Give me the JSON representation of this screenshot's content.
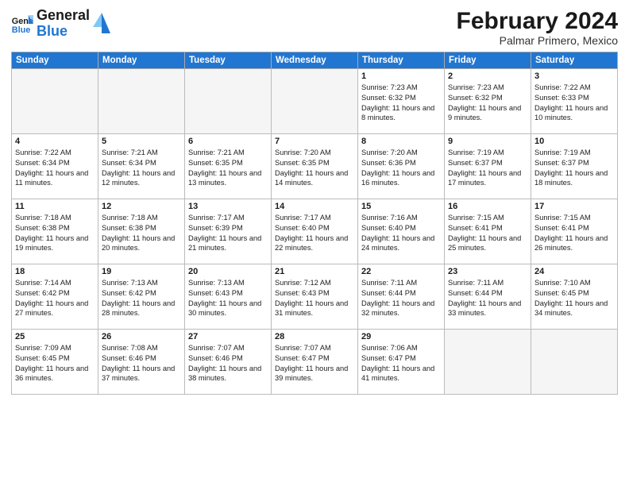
{
  "header": {
    "logo_text_general": "General",
    "logo_text_blue": "Blue",
    "month_title": "February 2024",
    "location": "Palmar Primero, Mexico"
  },
  "weekdays": [
    "Sunday",
    "Monday",
    "Tuesday",
    "Wednesday",
    "Thursday",
    "Friday",
    "Saturday"
  ],
  "weeks": [
    [
      {
        "day": "",
        "info": ""
      },
      {
        "day": "",
        "info": ""
      },
      {
        "day": "",
        "info": ""
      },
      {
        "day": "",
        "info": ""
      },
      {
        "day": "1",
        "info": "Sunrise: 7:23 AM\nSunset: 6:32 PM\nDaylight: 11 hours and 8 minutes."
      },
      {
        "day": "2",
        "info": "Sunrise: 7:23 AM\nSunset: 6:32 PM\nDaylight: 11 hours and 9 minutes."
      },
      {
        "day": "3",
        "info": "Sunrise: 7:22 AM\nSunset: 6:33 PM\nDaylight: 11 hours and 10 minutes."
      }
    ],
    [
      {
        "day": "4",
        "info": "Sunrise: 7:22 AM\nSunset: 6:34 PM\nDaylight: 11 hours and 11 minutes."
      },
      {
        "day": "5",
        "info": "Sunrise: 7:21 AM\nSunset: 6:34 PM\nDaylight: 11 hours and 12 minutes."
      },
      {
        "day": "6",
        "info": "Sunrise: 7:21 AM\nSunset: 6:35 PM\nDaylight: 11 hours and 13 minutes."
      },
      {
        "day": "7",
        "info": "Sunrise: 7:20 AM\nSunset: 6:35 PM\nDaylight: 11 hours and 14 minutes."
      },
      {
        "day": "8",
        "info": "Sunrise: 7:20 AM\nSunset: 6:36 PM\nDaylight: 11 hours and 16 minutes."
      },
      {
        "day": "9",
        "info": "Sunrise: 7:19 AM\nSunset: 6:37 PM\nDaylight: 11 hours and 17 minutes."
      },
      {
        "day": "10",
        "info": "Sunrise: 7:19 AM\nSunset: 6:37 PM\nDaylight: 11 hours and 18 minutes."
      }
    ],
    [
      {
        "day": "11",
        "info": "Sunrise: 7:18 AM\nSunset: 6:38 PM\nDaylight: 11 hours and 19 minutes."
      },
      {
        "day": "12",
        "info": "Sunrise: 7:18 AM\nSunset: 6:38 PM\nDaylight: 11 hours and 20 minutes."
      },
      {
        "day": "13",
        "info": "Sunrise: 7:17 AM\nSunset: 6:39 PM\nDaylight: 11 hours and 21 minutes."
      },
      {
        "day": "14",
        "info": "Sunrise: 7:17 AM\nSunset: 6:40 PM\nDaylight: 11 hours and 22 minutes."
      },
      {
        "day": "15",
        "info": "Sunrise: 7:16 AM\nSunset: 6:40 PM\nDaylight: 11 hours and 24 minutes."
      },
      {
        "day": "16",
        "info": "Sunrise: 7:15 AM\nSunset: 6:41 PM\nDaylight: 11 hours and 25 minutes."
      },
      {
        "day": "17",
        "info": "Sunrise: 7:15 AM\nSunset: 6:41 PM\nDaylight: 11 hours and 26 minutes."
      }
    ],
    [
      {
        "day": "18",
        "info": "Sunrise: 7:14 AM\nSunset: 6:42 PM\nDaylight: 11 hours and 27 minutes."
      },
      {
        "day": "19",
        "info": "Sunrise: 7:13 AM\nSunset: 6:42 PM\nDaylight: 11 hours and 28 minutes."
      },
      {
        "day": "20",
        "info": "Sunrise: 7:13 AM\nSunset: 6:43 PM\nDaylight: 11 hours and 30 minutes."
      },
      {
        "day": "21",
        "info": "Sunrise: 7:12 AM\nSunset: 6:43 PM\nDaylight: 11 hours and 31 minutes."
      },
      {
        "day": "22",
        "info": "Sunrise: 7:11 AM\nSunset: 6:44 PM\nDaylight: 11 hours and 32 minutes."
      },
      {
        "day": "23",
        "info": "Sunrise: 7:11 AM\nSunset: 6:44 PM\nDaylight: 11 hours and 33 minutes."
      },
      {
        "day": "24",
        "info": "Sunrise: 7:10 AM\nSunset: 6:45 PM\nDaylight: 11 hours and 34 minutes."
      }
    ],
    [
      {
        "day": "25",
        "info": "Sunrise: 7:09 AM\nSunset: 6:45 PM\nDaylight: 11 hours and 36 minutes."
      },
      {
        "day": "26",
        "info": "Sunrise: 7:08 AM\nSunset: 6:46 PM\nDaylight: 11 hours and 37 minutes."
      },
      {
        "day": "27",
        "info": "Sunrise: 7:07 AM\nSunset: 6:46 PM\nDaylight: 11 hours and 38 minutes."
      },
      {
        "day": "28",
        "info": "Sunrise: 7:07 AM\nSunset: 6:47 PM\nDaylight: 11 hours and 39 minutes."
      },
      {
        "day": "29",
        "info": "Sunrise: 7:06 AM\nSunset: 6:47 PM\nDaylight: 11 hours and 41 minutes."
      },
      {
        "day": "",
        "info": ""
      },
      {
        "day": "",
        "info": ""
      }
    ]
  ]
}
